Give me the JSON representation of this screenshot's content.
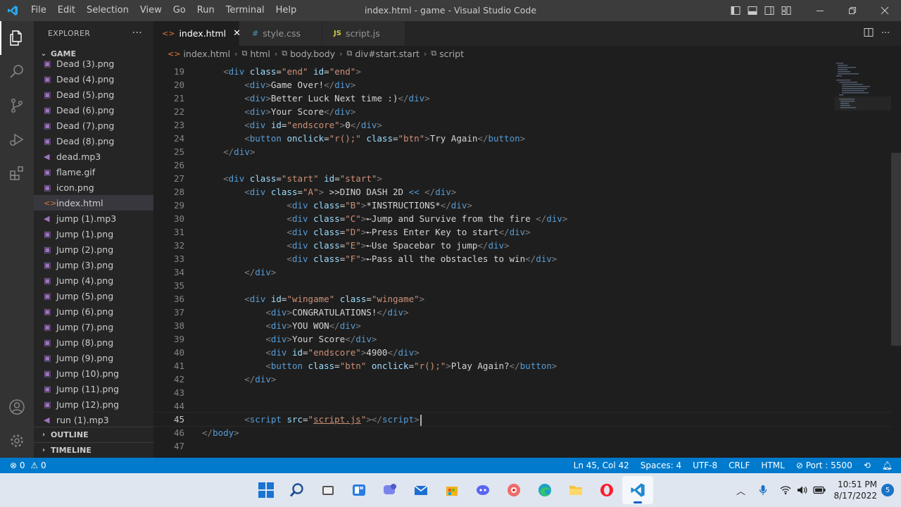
{
  "window": {
    "title": "index.html - game - Visual Studio Code",
    "menu": [
      "File",
      "Edit",
      "Selection",
      "View",
      "Go",
      "Run",
      "Terminal",
      "Help"
    ]
  },
  "sidebar": {
    "header": "EXPLORER",
    "more": "···",
    "folder": "GAME",
    "files": [
      {
        "name": "Dead (3).png",
        "type": "png"
      },
      {
        "name": "Dead (4).png",
        "type": "png"
      },
      {
        "name": "Dead (5).png",
        "type": "png"
      },
      {
        "name": "Dead (6).png",
        "type": "png"
      },
      {
        "name": "Dead (7).png",
        "type": "png"
      },
      {
        "name": "Dead (8).png",
        "type": "png"
      },
      {
        "name": "dead.mp3",
        "type": "mp3"
      },
      {
        "name": "flame.gif",
        "type": "gif"
      },
      {
        "name": "icon.png",
        "type": "png"
      },
      {
        "name": "index.html",
        "type": "html",
        "active": true
      },
      {
        "name": "jump (1).mp3",
        "type": "mp3"
      },
      {
        "name": "Jump (1).png",
        "type": "png"
      },
      {
        "name": "Jump (2).png",
        "type": "png"
      },
      {
        "name": "Jump (3).png",
        "type": "png"
      },
      {
        "name": "Jump (4).png",
        "type": "png"
      },
      {
        "name": "Jump (5).png",
        "type": "png"
      },
      {
        "name": "Jump (6).png",
        "type": "png"
      },
      {
        "name": "Jump (7).png",
        "type": "png"
      },
      {
        "name": "Jump (8).png",
        "type": "png"
      },
      {
        "name": "Jump (9).png",
        "type": "png"
      },
      {
        "name": "Jump (10).png",
        "type": "png"
      },
      {
        "name": "Jump (11).png",
        "type": "png"
      },
      {
        "name": "Jump (12).png",
        "type": "png"
      },
      {
        "name": "run (1).mp3",
        "type": "mp3"
      }
    ],
    "outline": "OUTLINE",
    "timeline": "TIMELINE"
  },
  "tabs": [
    {
      "label": "index.html",
      "icon": "<>",
      "active": true,
      "close": "✕"
    },
    {
      "label": "style.css",
      "icon": "#",
      "active": false
    },
    {
      "label": "script.js",
      "icon": "JS",
      "active": false
    }
  ],
  "breadcrumbs": [
    "index.html",
    "html",
    "body.body",
    "div#start.start",
    "script"
  ],
  "code": {
    "current_line": 45,
    "lines": [
      {
        "n": 19,
        "tokens": [
          [
            "x",
            "    "
          ],
          [
            "p",
            "<"
          ],
          [
            "t",
            "div"
          ],
          [
            "x",
            " "
          ],
          [
            "a",
            "class"
          ],
          [
            "x",
            "="
          ],
          [
            "s",
            "\"end\""
          ],
          [
            "x",
            " "
          ],
          [
            "a",
            "id"
          ],
          [
            "x",
            "="
          ],
          [
            "s",
            "\"end\""
          ],
          [
            "p",
            ">"
          ]
        ]
      },
      {
        "n": 20,
        "tokens": [
          [
            "x",
            "        "
          ],
          [
            "p",
            "<"
          ],
          [
            "t",
            "div"
          ],
          [
            "p",
            ">"
          ],
          [
            "x",
            "Game Over!"
          ],
          [
            "p",
            "</"
          ],
          [
            "t",
            "div"
          ],
          [
            "p",
            ">"
          ]
        ]
      },
      {
        "n": 21,
        "tokens": [
          [
            "x",
            "        "
          ],
          [
            "p",
            "<"
          ],
          [
            "t",
            "div"
          ],
          [
            "p",
            ">"
          ],
          [
            "x",
            "Better Luck Next time :)"
          ],
          [
            "p",
            "</"
          ],
          [
            "t",
            "div"
          ],
          [
            "p",
            ">"
          ]
        ]
      },
      {
        "n": 22,
        "tokens": [
          [
            "x",
            "        "
          ],
          [
            "p",
            "<"
          ],
          [
            "t",
            "div"
          ],
          [
            "p",
            ">"
          ],
          [
            "x",
            "Your Score"
          ],
          [
            "p",
            "</"
          ],
          [
            "t",
            "div"
          ],
          [
            "p",
            ">"
          ]
        ]
      },
      {
        "n": 23,
        "tokens": [
          [
            "x",
            "        "
          ],
          [
            "p",
            "<"
          ],
          [
            "t",
            "div"
          ],
          [
            "x",
            " "
          ],
          [
            "a",
            "id"
          ],
          [
            "x",
            "="
          ],
          [
            "s",
            "\"endscore\""
          ],
          [
            "p",
            ">"
          ],
          [
            "x",
            "0"
          ],
          [
            "p",
            "</"
          ],
          [
            "t",
            "div"
          ],
          [
            "p",
            ">"
          ]
        ]
      },
      {
        "n": 24,
        "tokens": [
          [
            "x",
            "        "
          ],
          [
            "p",
            "<"
          ],
          [
            "t",
            "button"
          ],
          [
            "x",
            " "
          ],
          [
            "a",
            "onclick"
          ],
          [
            "x",
            "="
          ],
          [
            "s",
            "\"r();\""
          ],
          [
            "x",
            " "
          ],
          [
            "a",
            "class"
          ],
          [
            "x",
            "="
          ],
          [
            "s",
            "\"btn\""
          ],
          [
            "p",
            ">"
          ],
          [
            "x",
            "Try Again"
          ],
          [
            "p",
            "</"
          ],
          [
            "t",
            "button"
          ],
          [
            "p",
            ">"
          ]
        ]
      },
      {
        "n": 25,
        "tokens": [
          [
            "x",
            "    "
          ],
          [
            "p",
            "</"
          ],
          [
            "t",
            "div"
          ],
          [
            "p",
            ">"
          ]
        ]
      },
      {
        "n": 26,
        "tokens": []
      },
      {
        "n": 27,
        "tokens": [
          [
            "x",
            "    "
          ],
          [
            "p",
            "<"
          ],
          [
            "t",
            "div"
          ],
          [
            "x",
            " "
          ],
          [
            "a",
            "class"
          ],
          [
            "x",
            "="
          ],
          [
            "s",
            "\"start\""
          ],
          [
            "x",
            " "
          ],
          [
            "a",
            "id"
          ],
          [
            "x",
            "="
          ],
          [
            "s",
            "\"start\""
          ],
          [
            "p",
            ">"
          ]
        ]
      },
      {
        "n": 28,
        "tokens": [
          [
            "x",
            "        "
          ],
          [
            "p",
            "<"
          ],
          [
            "t",
            "div"
          ],
          [
            "x",
            " "
          ],
          [
            "a",
            "class"
          ],
          [
            "x",
            "="
          ],
          [
            "s",
            "\"A\""
          ],
          [
            "p",
            ">"
          ],
          [
            "x",
            " >>DINO DASH 2D "
          ],
          [
            "t",
            "<<"
          ],
          [
            "x",
            " "
          ],
          [
            "p",
            "</"
          ],
          [
            "t",
            "div"
          ],
          [
            "p",
            ">"
          ]
        ]
      },
      {
        "n": 29,
        "tokens": [
          [
            "x",
            "                "
          ],
          [
            "p",
            "<"
          ],
          [
            "t",
            "div"
          ],
          [
            "x",
            " "
          ],
          [
            "a",
            "class"
          ],
          [
            "x",
            "="
          ],
          [
            "s",
            "\"B\""
          ],
          [
            "p",
            ">"
          ],
          [
            "x",
            "*INSTRUCTIONS*"
          ],
          [
            "p",
            "</"
          ],
          [
            "t",
            "div"
          ],
          [
            "p",
            ">"
          ]
        ]
      },
      {
        "n": 30,
        "tokens": [
          [
            "x",
            "                "
          ],
          [
            "p",
            "<"
          ],
          [
            "t",
            "div"
          ],
          [
            "x",
            " "
          ],
          [
            "a",
            "class"
          ],
          [
            "x",
            "="
          ],
          [
            "s",
            "\"C\""
          ],
          [
            "p",
            ">"
          ],
          [
            "x",
            "➸Jump and Survive from the fire "
          ],
          [
            "p",
            "</"
          ],
          [
            "t",
            "div"
          ],
          [
            "p",
            ">"
          ]
        ]
      },
      {
        "n": 31,
        "tokens": [
          [
            "x",
            "                "
          ],
          [
            "p",
            "<"
          ],
          [
            "t",
            "div"
          ],
          [
            "x",
            " "
          ],
          [
            "a",
            "class"
          ],
          [
            "x",
            "="
          ],
          [
            "s",
            "\"D\""
          ],
          [
            "p",
            ">"
          ],
          [
            "x",
            "➸Press Enter Key to start"
          ],
          [
            "p",
            "</"
          ],
          [
            "t",
            "div"
          ],
          [
            "p",
            ">"
          ]
        ]
      },
      {
        "n": 32,
        "tokens": [
          [
            "x",
            "                "
          ],
          [
            "p",
            "<"
          ],
          [
            "t",
            "div"
          ],
          [
            "x",
            " "
          ],
          [
            "a",
            "class"
          ],
          [
            "x",
            "="
          ],
          [
            "s",
            "\"E\""
          ],
          [
            "p",
            ">"
          ],
          [
            "x",
            "➸Use Spacebar to jump"
          ],
          [
            "p",
            "</"
          ],
          [
            "t",
            "div"
          ],
          [
            "p",
            ">"
          ]
        ]
      },
      {
        "n": 33,
        "tokens": [
          [
            "x",
            "                "
          ],
          [
            "p",
            "<"
          ],
          [
            "t",
            "div"
          ],
          [
            "x",
            " "
          ],
          [
            "a",
            "class"
          ],
          [
            "x",
            "="
          ],
          [
            "s",
            "\"F\""
          ],
          [
            "p",
            ">"
          ],
          [
            "x",
            "➸Pass all the obstacles to win"
          ],
          [
            "p",
            "</"
          ],
          [
            "t",
            "div"
          ],
          [
            "p",
            ">"
          ]
        ]
      },
      {
        "n": 34,
        "tokens": [
          [
            "x",
            "        "
          ],
          [
            "p",
            "</"
          ],
          [
            "t",
            "div"
          ],
          [
            "p",
            ">"
          ]
        ]
      },
      {
        "n": 35,
        "tokens": []
      },
      {
        "n": 36,
        "tokens": [
          [
            "x",
            "        "
          ],
          [
            "p",
            "<"
          ],
          [
            "t",
            "div"
          ],
          [
            "x",
            " "
          ],
          [
            "a",
            "id"
          ],
          [
            "x",
            "="
          ],
          [
            "s",
            "\"wingame\""
          ],
          [
            "x",
            " "
          ],
          [
            "a",
            "class"
          ],
          [
            "x",
            "="
          ],
          [
            "s",
            "\"wingame\""
          ],
          [
            "p",
            ">"
          ]
        ]
      },
      {
        "n": 37,
        "tokens": [
          [
            "x",
            "            "
          ],
          [
            "p",
            "<"
          ],
          [
            "t",
            "div"
          ],
          [
            "p",
            ">"
          ],
          [
            "x",
            "CONGRATULATIONS!"
          ],
          [
            "p",
            "</"
          ],
          [
            "t",
            "div"
          ],
          [
            "p",
            ">"
          ]
        ]
      },
      {
        "n": 38,
        "tokens": [
          [
            "x",
            "            "
          ],
          [
            "p",
            "<"
          ],
          [
            "t",
            "div"
          ],
          [
            "p",
            ">"
          ],
          [
            "x",
            "YOU WON"
          ],
          [
            "p",
            "</"
          ],
          [
            "t",
            "div"
          ],
          [
            "p",
            ">"
          ]
        ]
      },
      {
        "n": 39,
        "tokens": [
          [
            "x",
            "            "
          ],
          [
            "p",
            "<"
          ],
          [
            "t",
            "div"
          ],
          [
            "p",
            ">"
          ],
          [
            "x",
            "Your Score"
          ],
          [
            "p",
            "</"
          ],
          [
            "t",
            "div"
          ],
          [
            "p",
            ">"
          ]
        ]
      },
      {
        "n": 40,
        "tokens": [
          [
            "x",
            "            "
          ],
          [
            "p",
            "<"
          ],
          [
            "t",
            "div"
          ],
          [
            "x",
            " "
          ],
          [
            "a",
            "id"
          ],
          [
            "x",
            "="
          ],
          [
            "s",
            "\"endscore\""
          ],
          [
            "p",
            ">"
          ],
          [
            "x",
            "4900"
          ],
          [
            "p",
            "</"
          ],
          [
            "t",
            "div"
          ],
          [
            "p",
            ">"
          ]
        ]
      },
      {
        "n": 41,
        "tokens": [
          [
            "x",
            "            "
          ],
          [
            "p",
            "<"
          ],
          [
            "t",
            "button"
          ],
          [
            "x",
            " "
          ],
          [
            "a",
            "class"
          ],
          [
            "x",
            "="
          ],
          [
            "s",
            "\"btn\""
          ],
          [
            "x",
            " "
          ],
          [
            "a",
            "onclick"
          ],
          [
            "x",
            "="
          ],
          [
            "s",
            "\"r();\""
          ],
          [
            "p",
            ">"
          ],
          [
            "x",
            "Play Again?"
          ],
          [
            "p",
            "</"
          ],
          [
            "t",
            "button"
          ],
          [
            "p",
            ">"
          ]
        ]
      },
      {
        "n": 42,
        "tokens": [
          [
            "x",
            "        "
          ],
          [
            "p",
            "</"
          ],
          [
            "t",
            "div"
          ],
          [
            "p",
            ">"
          ]
        ]
      },
      {
        "n": 43,
        "tokens": []
      },
      {
        "n": 44,
        "tokens": []
      },
      {
        "n": 45,
        "tokens": [
          [
            "x",
            "        "
          ],
          [
            "p",
            "<"
          ],
          [
            "t",
            "script"
          ],
          [
            "x",
            " "
          ],
          [
            "a",
            "src"
          ],
          [
            "x",
            "="
          ],
          [
            "s",
            "\""
          ],
          [
            "sq",
            "script.js"
          ],
          [
            "s",
            "\""
          ],
          [
            "p",
            ">"
          ],
          [
            "p",
            "</"
          ],
          [
            "t",
            "script"
          ],
          [
            "p",
            ">"
          ]
        ]
      },
      {
        "n": 46,
        "tokens": [
          [
            "p",
            "</"
          ],
          [
            "t",
            "body"
          ],
          [
            "p",
            ">"
          ]
        ]
      },
      {
        "n": 47,
        "tokens": []
      }
    ]
  },
  "statusbar": {
    "errors": "0",
    "warnings": "0",
    "position": "Ln 45, Col 42",
    "spaces": "Spaces: 4",
    "encoding": "UTF-8",
    "eol": "CRLF",
    "language": "HTML",
    "port": "Port : 5500"
  },
  "taskbar": {
    "time": "10:51 PM",
    "date": "8/17/2022",
    "notifications": "5"
  },
  "colors": {
    "accent": "#007acc",
    "titlebar": "#3c3c3c",
    "sidebar": "#252526",
    "editor": "#1e1e1e"
  }
}
